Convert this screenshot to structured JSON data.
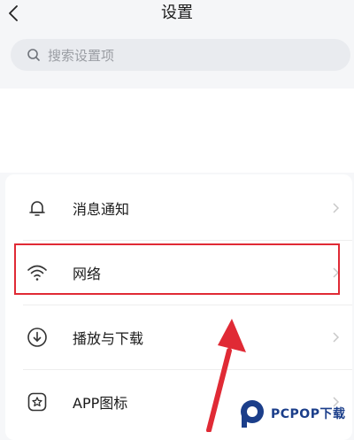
{
  "header": {
    "title": "设置"
  },
  "search": {
    "placeholder": "搜索设置项"
  },
  "settings": {
    "items": [
      {
        "label": "消息通知",
        "icon": "bell-icon"
      },
      {
        "label": "网络",
        "icon": "wifi-icon"
      },
      {
        "label": "播放与下载",
        "icon": "download-icon"
      },
      {
        "label": "APP图标",
        "icon": "app-icon"
      }
    ]
  },
  "colors": {
    "highlight": "#e02a35",
    "background": "#f6f7f9"
  },
  "watermark": {
    "text": "PCPOP下载"
  }
}
